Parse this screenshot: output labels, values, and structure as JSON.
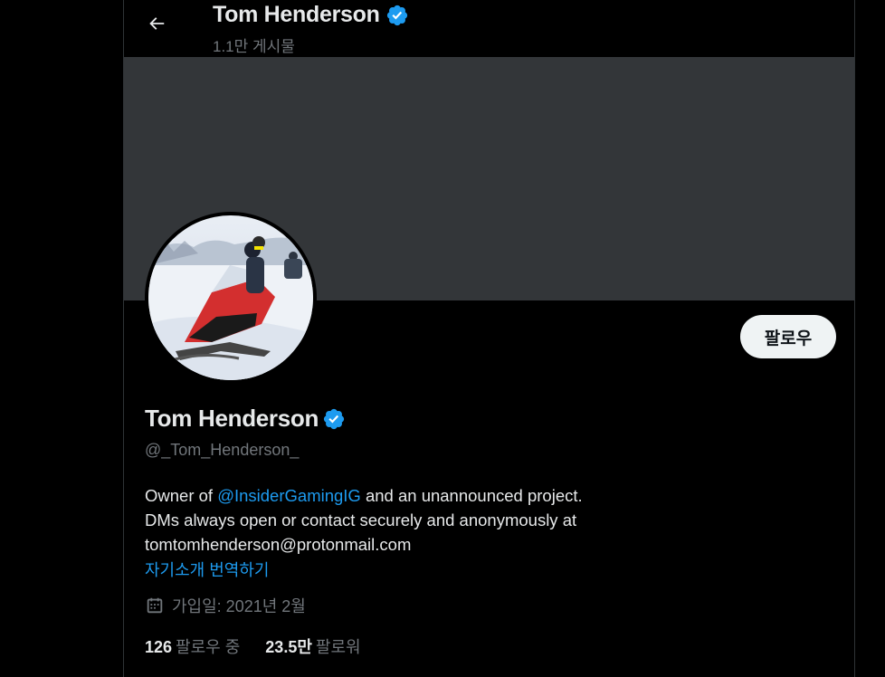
{
  "header": {
    "name": "Tom Henderson",
    "post_count": "1.1만 게시물"
  },
  "profile": {
    "name": "Tom Henderson",
    "handle": "@_Tom_Henderson_",
    "follow_label": "팔로우",
    "bio": {
      "prefix": "Owner of ",
      "mention": "@InsiderGamingIG",
      "suffix": " and an unannounced project.",
      "line2": "DMs always open or contact securely and anonymously at",
      "line3": "tomtomhenderson@protonmail.com"
    },
    "translate_label": "자기소개 번역하기",
    "joined": "가입일: 2021년 2월",
    "following_count": "126",
    "following_label": "팔로우 중",
    "followers_count": "23.5만",
    "followers_label": "팔로워"
  },
  "colors": {
    "background": "#000000",
    "banner": "#333639",
    "accent": "#1d9bf0",
    "muted_text": "#71767b",
    "primary_text": "#e7e9ea",
    "follow_button_bg": "#eff3f4"
  },
  "icons": {
    "back": "arrow-left-icon",
    "verified": "verified-badge-icon",
    "calendar": "calendar-icon"
  }
}
